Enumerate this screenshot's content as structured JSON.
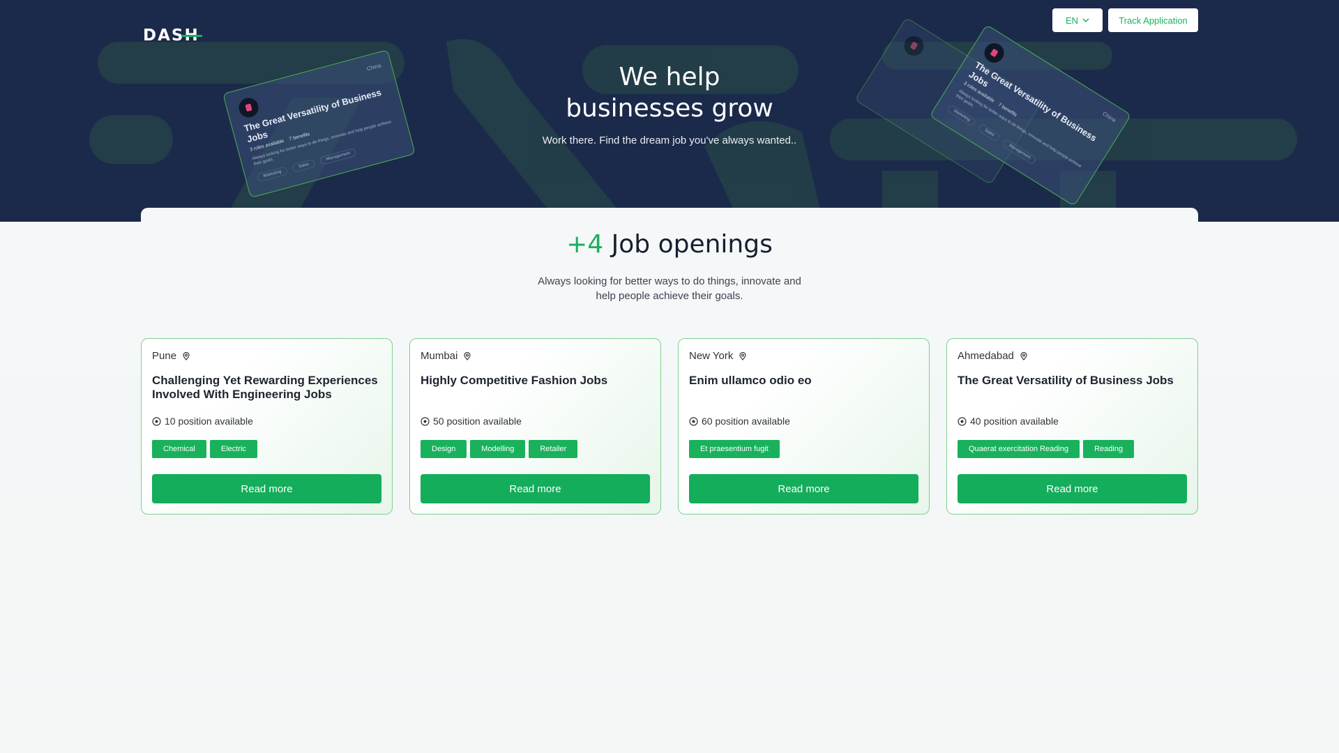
{
  "header": {
    "logo": "DASH",
    "language": "EN",
    "track_label": "Track Application"
  },
  "hero": {
    "title_line1": "We help",
    "title_line2": "businesses grow",
    "subtitle": "Work there. Find the dream job you've always wanted.."
  },
  "deco_cards": [
    {
      "city": "China",
      "title": "The Great Versatility of Business Jobs",
      "roles": "3 roles available",
      "benefits": "7 benefits",
      "desc": "Always looking for better ways to do things, innovate and help people achieve their goals.",
      "tags": [
        "Marketing",
        "Sales",
        "Management"
      ]
    },
    {
      "city": "China",
      "title": "The Great Versatility of Business Jobs",
      "roles": "3 roles available",
      "benefits": "7 benefits",
      "desc": "Always looking for better ways to do things, innovate and help people achieve their goals.",
      "tags": [
        "Marketing",
        "Sales",
        "Management"
      ]
    }
  ],
  "openings": {
    "count": "+4",
    "label": " Job openings",
    "subtitle": "Always looking for better ways to do things, innovate and help people achieve their goals."
  },
  "jobs": [
    {
      "city": "Pune",
      "title": "Challenging Yet Rewarding Experiences Involved With Engineering Jobs",
      "positions": "10 position available",
      "tags": [
        "Chemical",
        "Electric"
      ],
      "button": "Read more"
    },
    {
      "city": "Mumbai",
      "title": "Highly Competitive Fashion Jobs",
      "positions": "50 position available",
      "tags": [
        "Design",
        "Modelling",
        "Retailer"
      ],
      "button": "Read more"
    },
    {
      "city": "New York",
      "title": "Enim ullamco odio eo",
      "positions": "60 position available",
      "tags": [
        "Et praesentium fugit"
      ],
      "button": "Read more"
    },
    {
      "city": "Ahmedabad",
      "title": "The Great Versatility of Business Jobs",
      "positions": "40 position available",
      "tags": [
        "Quaerat exercitation Reading",
        "Reading"
      ],
      "button": "Read more"
    }
  ],
  "colors": {
    "hero_bg": "#1b2a4a",
    "accent": "#19b15c",
    "button": "#13ad5b"
  }
}
